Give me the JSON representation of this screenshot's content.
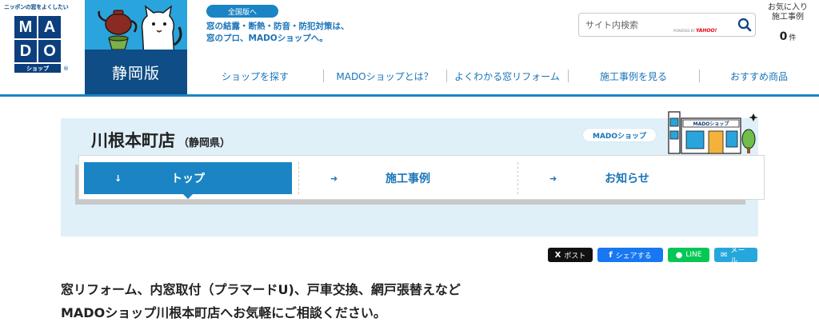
{
  "header": {
    "logo_tagline": "ニッポンの窓をよくしたい",
    "logo_letters": [
      "M",
      "A",
      "D",
      "O"
    ],
    "logo_sub": "ショップ",
    "logo_reg": "®",
    "region_label": "静岡版",
    "national_pill": "全国版へ",
    "tagline": "窓の結露・断熱・防音・防犯対策は、\n窓のプロ、MADOショップへ。",
    "search": {
      "placeholder": "サイト内検索",
      "powered_by": "POWERED BY",
      "powered_brand": "YAHOO!"
    },
    "favorites": {
      "label": "お気に入り\n施工事例",
      "count": "0",
      "unit": "件"
    },
    "nav": [
      {
        "label": "ショップを探す"
      },
      {
        "label": "MADOショップとは？"
      },
      {
        "label": "よくわかる窓リフォーム"
      },
      {
        "label": "施工事例を見る"
      },
      {
        "label": "おすすめ商品"
      }
    ]
  },
  "shop": {
    "name": "川根本町店",
    "prefecture": "（静岡県）",
    "badge": "MADOショップ",
    "sign": "MADOショップ",
    "tabs": [
      {
        "label": "トップ",
        "arrow": "↓",
        "active": true
      },
      {
        "label": "施工事例",
        "arrow": "➜",
        "active": false
      },
      {
        "label": "お知らせ",
        "arrow": "➜",
        "active": false
      }
    ]
  },
  "share": [
    {
      "label": "ポスト",
      "icon": "X",
      "icon_name": "x-icon",
      "color": "#111111"
    },
    {
      "label": "シェアする",
      "icon": "f",
      "icon_name": "facebook-icon",
      "color": "#1877f2"
    },
    {
      "label": "LINE",
      "icon": "●",
      "icon_name": "line-icon",
      "color": "#06c755"
    },
    {
      "label": "メール",
      "icon": "✉",
      "icon_name": "mail-icon",
      "color": "#25a7dc"
    }
  ],
  "intro": {
    "line1": "窓リフォーム、内窓取付（プラマードU)、戸車交換、網戸張替えなど",
    "line2": "MADOショップ川根本町店へお気軽にご相談ください。"
  },
  "colors": {
    "brand_navy": "#0c3f7e",
    "accent_blue": "#1a84c4",
    "banner_bg": "#dff0f8"
  }
}
